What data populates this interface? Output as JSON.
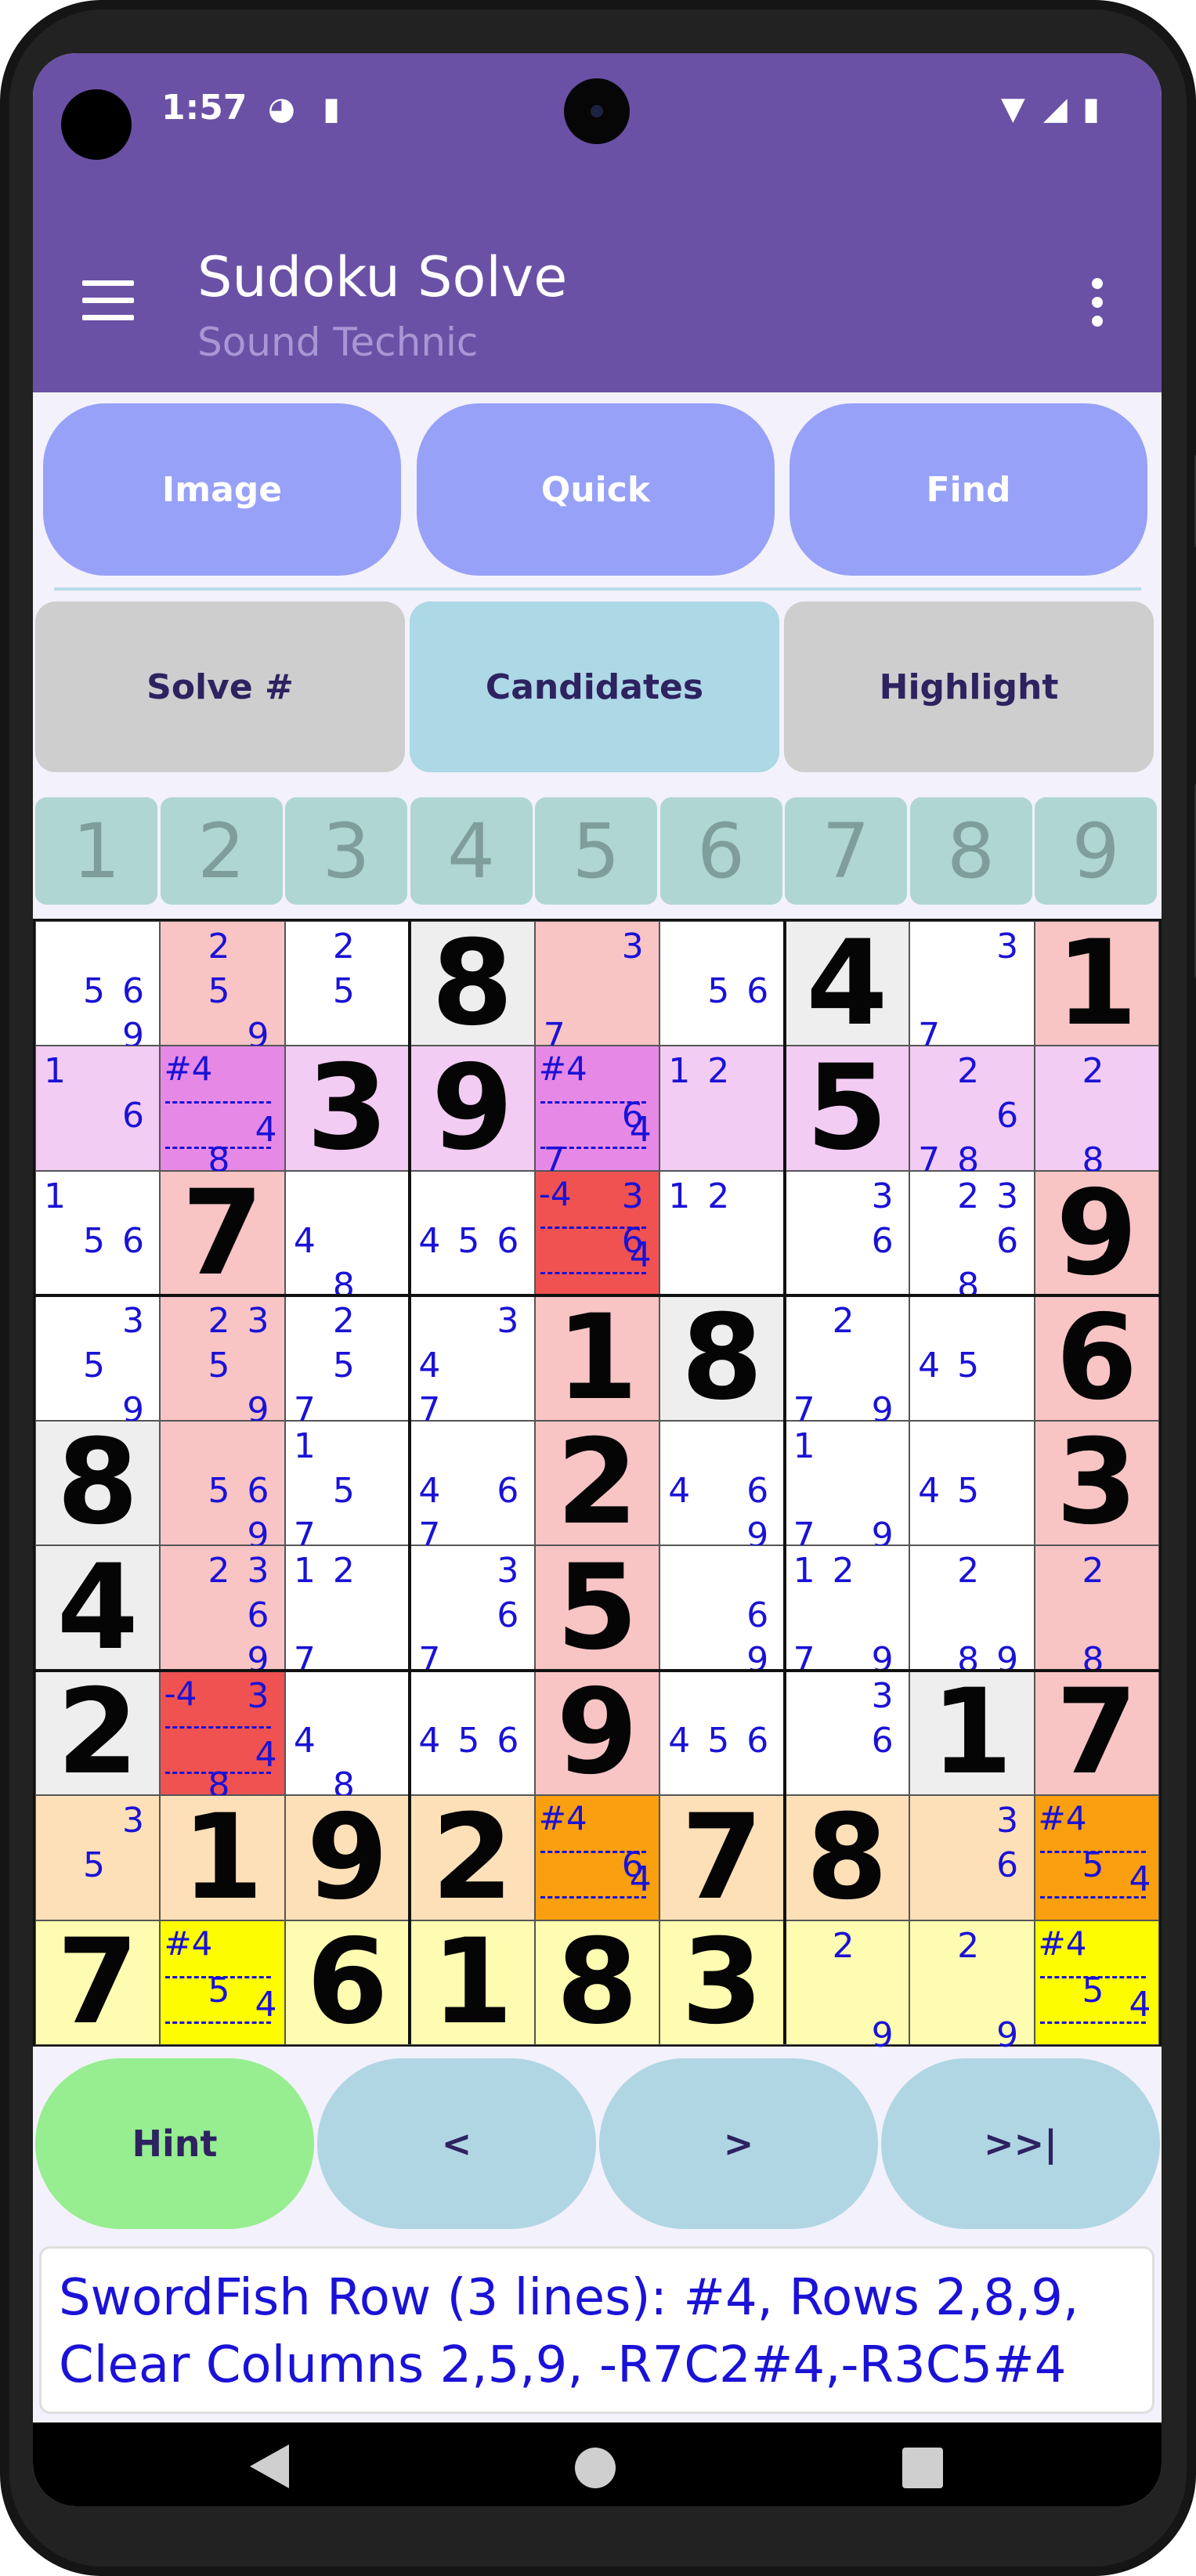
{
  "status_bar": {
    "time": "1:57",
    "icons": [
      "app-notification-icon",
      "sd-card-icon",
      "wifi-icon",
      "signal-icon",
      "battery-icon"
    ]
  },
  "app_bar": {
    "title": "Sudoku Solve",
    "subtitle": "Sound Technic",
    "icons": [
      "menu-icon",
      "overflow-menu-icon"
    ]
  },
  "top_buttons": [
    "Image",
    "Quick",
    "Find"
  ],
  "mode_buttons": [
    {
      "label": "Solve #",
      "active": false
    },
    {
      "label": "Candidates",
      "active": true
    },
    {
      "label": "Highlight",
      "active": false
    }
  ],
  "digit_selector": [
    "1",
    "2",
    "3",
    "4",
    "5",
    "6",
    "7",
    "8",
    "9"
  ],
  "board": {
    "values": [
      "0 0 0 8 0 0 4 0 1",
      "0 0 3 9 0 0 5 0 0",
      "0 7 0 0 0 0 0 0 9",
      "0 0 0 0 1 8 0 0 6",
      "8 0 0 0 2 0 0 0 3",
      "4 0 0 0 5 0 0 0 0",
      "2 0 0 0 9 0 0 1 7",
      "0 1 9 2 0 7 8 0 0",
      "7 0 6 1 8 3 0 0 0"
    ],
    "candidates": [
      [
        "569",
        "259",
        "25",
        "",
        "37",
        "56",
        "",
        "37",
        ""
      ],
      [
        "16",
        "#4|48",
        "",
        "",
        "#4|467",
        "12",
        "",
        "2678",
        "28"
      ],
      [
        "156",
        "",
        "48",
        "456",
        "-4|346",
        "12",
        "36",
        "2368",
        ""
      ],
      [
        "359",
        "2359",
        "257",
        "347",
        "",
        "",
        "279",
        "45",
        ""
      ],
      [
        "",
        "569",
        "157",
        "467",
        "",
        "469",
        "179",
        "45",
        ""
      ],
      [
        "",
        "2369",
        "127",
        "367",
        "",
        "69",
        "1279",
        "289",
        "28"
      ],
      [
        "",
        "-4|348",
        "48",
        "456",
        "",
        "456",
        "36",
        "",
        ""
      ],
      [
        "35",
        "",
        "",
        "",
        "#4|46",
        "",
        "",
        "36",
        "#4|45"
      ],
      [
        "",
        "#4|45",
        "",
        "",
        "",
        "",
        "29",
        "29",
        "#4|45"
      ]
    ],
    "cell_colors": [
      [
        "w",
        "p",
        "w",
        "g",
        "p",
        "w",
        "g",
        "w",
        "p"
      ],
      [
        "l",
        "m",
        "l",
        "l",
        "m",
        "l",
        "l",
        "l",
        "l"
      ],
      [
        "w",
        "p",
        "w",
        "w",
        "r",
        "w",
        "w",
        "w",
        "p"
      ],
      [
        "w",
        "p",
        "w",
        "w",
        "p",
        "g",
        "w",
        "w",
        "p"
      ],
      [
        "g",
        "p",
        "w",
        "w",
        "p",
        "w",
        "w",
        "w",
        "p"
      ],
      [
        "g",
        "p",
        "w",
        "w",
        "p",
        "w",
        "w",
        "w",
        "p"
      ],
      [
        "g",
        "r",
        "w",
        "w",
        "p",
        "w",
        "w",
        "g",
        "p"
      ],
      [
        "o",
        "o",
        "o",
        "o",
        "O",
        "o",
        "o",
        "o",
        "O"
      ],
      [
        "y",
        "Y",
        "y",
        "y",
        "y",
        "y",
        "y",
        "y",
        "Y"
      ]
    ],
    "palette": {
      "w": "#ffffff",
      "g": "#eeeeee",
      "p": "#f8c4c4",
      "l": "#f2ccf2",
      "m": "#e689e6",
      "r": "#f05252",
      "o": "#fde0b8",
      "O": "#fa9f10",
      "y": "#fefcb0",
      "Y": "#fefc00"
    }
  },
  "bottom_buttons": [
    {
      "label": "Hint",
      "color": "#96ee90"
    },
    {
      "label": "<",
      "color": "#b0d6e4"
    },
    {
      "label": ">",
      "color": "#b0d6e4"
    },
    {
      "label": ">>|",
      "color": "#b0d6e4"
    }
  ],
  "hint_message": {
    "line1": "SwordFish Row (3 lines): #4, Rows 2,8,9,",
    "line2": "Clear Columns 2,5,9, -R7C2#4,-R3C5#4"
  },
  "nav_bar": [
    "back-icon",
    "home-icon",
    "recents-icon"
  ]
}
